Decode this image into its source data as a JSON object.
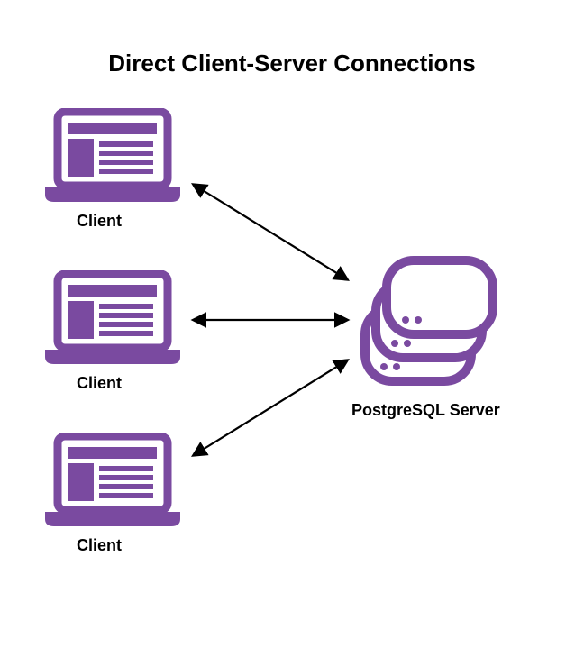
{
  "title": "Direct Client-Server Connections",
  "clients": [
    {
      "label": "Client"
    },
    {
      "label": "Client"
    },
    {
      "label": "Client"
    }
  ],
  "server": {
    "label": "PostgreSQL Server"
  },
  "colors": {
    "purple": "#7a4aa0",
    "black": "#000000"
  }
}
